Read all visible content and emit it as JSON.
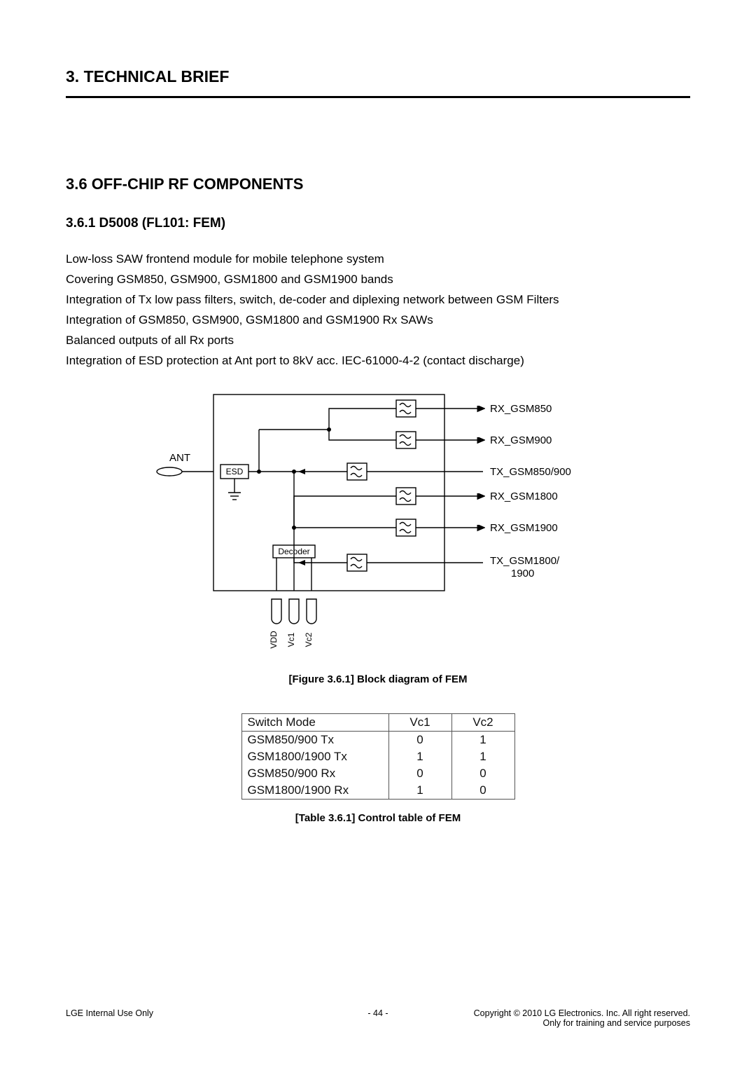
{
  "chapter": "3. TECHNICAL BRIEF",
  "section": "3.6 OFF-CHIP RF COMPONENTS",
  "subsection": "3.6.1 D5008 (FL101: FEM)",
  "body": [
    "Low-loss SAW frontend module for mobile telephone system",
    "Covering GSM850, GSM900, GSM1800 and GSM1900 bands",
    "Integration of Tx low pass filters, switch, de-coder and diplexing network between GSM Filters",
    "Integration of GSM850, GSM900, GSM1800 and GSM1900 Rx SAWs",
    "Balanced outputs of all Rx ports",
    "Integration of ESD protection at Ant port to 8kV acc. IEC-61000-4-2 (contact discharge)"
  ],
  "diagram": {
    "ant_label": "ANT",
    "esd_label": "ESD",
    "decoder_label": "Decoder",
    "vdd_label": "VDD",
    "vc1_label": "Vc1",
    "vc2_label": "Vc2",
    "outputs": [
      "RX_GSM850",
      "RX_GSM900",
      "TX_GSM850/900",
      "RX_GSM1800",
      "RX_GSM1900",
      "TX_GSM1800/",
      "1900"
    ]
  },
  "figure_caption": "[Figure 3.6.1] Block diagram of FEM",
  "table": {
    "header": [
      "Switch Mode",
      "Vc1",
      "Vc2"
    ],
    "rows": [
      [
        "GSM850/900 Tx",
        "0",
        "1"
      ],
      [
        "GSM1800/1900 Tx",
        "1",
        "1"
      ],
      [
        "GSM850/900 Rx",
        "0",
        "0"
      ],
      [
        "GSM1800/1900 Rx",
        "1",
        "0"
      ]
    ]
  },
  "table_caption": "[Table 3.6.1] Control table of FEM",
  "footer": {
    "left": "LGE Internal Use Only",
    "center": "- 44 -",
    "right1": "Copyright © 2010 LG Electronics. Inc. All right reserved.",
    "right2": "Only for training and service purposes"
  }
}
